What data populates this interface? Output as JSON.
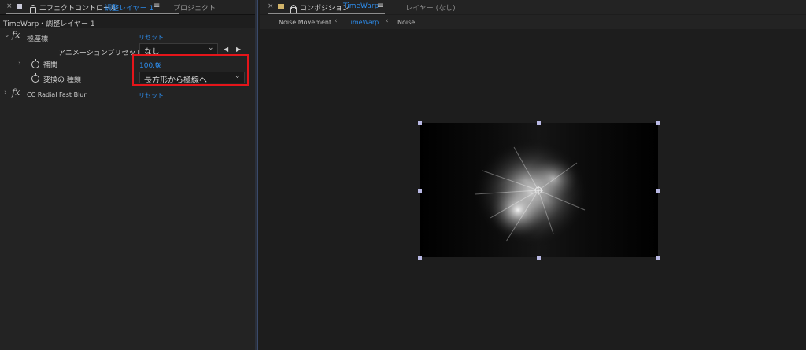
{
  "left_header": {
    "close": "×",
    "tab_prefix": "エフェクトコントロール",
    "tab_layer": "調整レイヤー 1",
    "tab_menu": "≡",
    "project_tab": "プロジェクト"
  },
  "breadcrumb": "TimeWarp・調整レイヤー 1",
  "effects": {
    "polar": {
      "name": "極座標",
      "reset": "リセット",
      "preset_label": "アニメーションプリセット：",
      "preset_value": "なし",
      "prev": "◀",
      "next": "▶",
      "interp_label": "補間",
      "interp_value": "100.0",
      "interp_unit": "%",
      "conv_label": "変換の 種類",
      "conv_value": "長方形から極線へ"
    },
    "radial": {
      "name": "CC Radial Fast Blur",
      "reset": "リセット"
    }
  },
  "right_header": {
    "close": "×",
    "tab_prefix": "コンポジション",
    "tab_name": "TimeWarp",
    "tab_menu": "≡",
    "layer_tab": "レイヤー (なし)"
  },
  "comp_tabs": {
    "first": "Noise Movement",
    "active": "TimeWarp",
    "last": "Noise",
    "sep_left": "‹",
    "sep_right": "‹"
  },
  "colors": {
    "accent": "#2d8ceb",
    "highlight": "#e5151a",
    "handle": "#b9b9e4"
  }
}
